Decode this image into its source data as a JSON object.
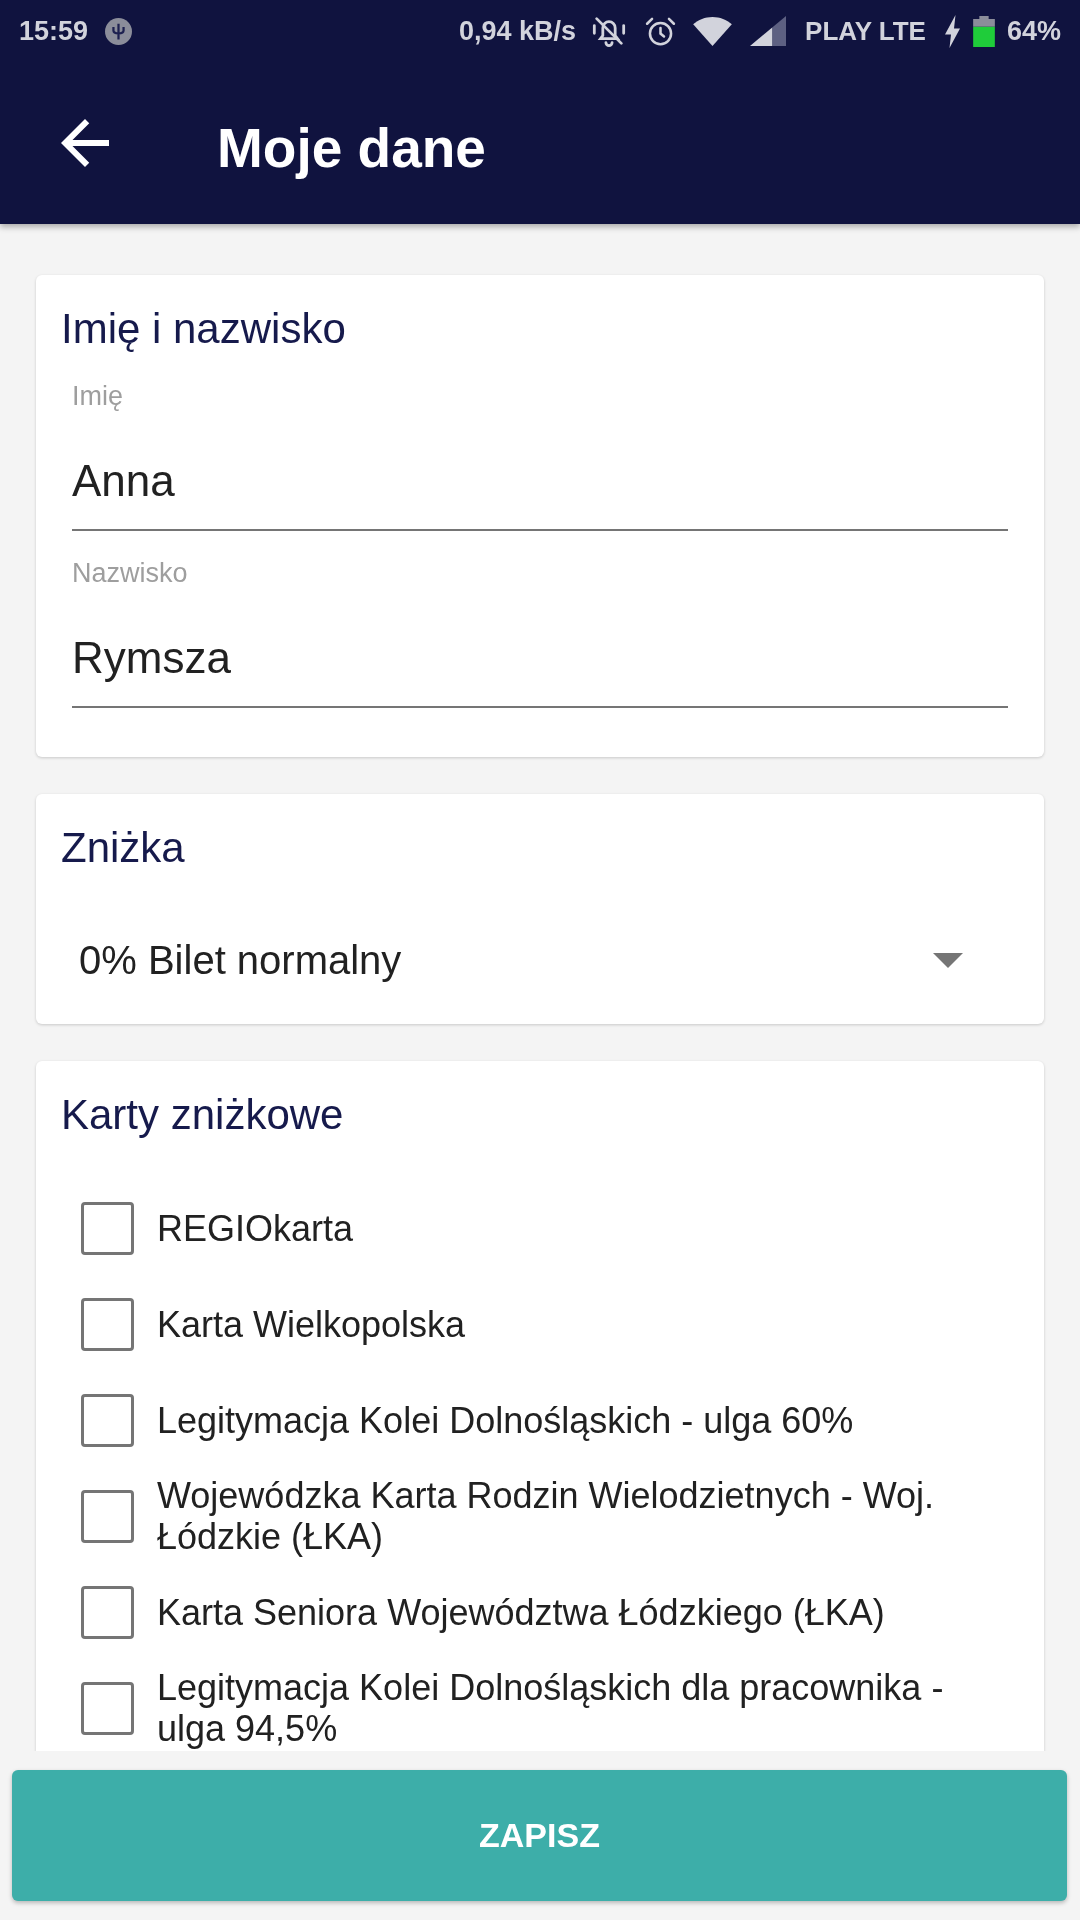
{
  "status_bar": {
    "time": "15:59",
    "network_speed": "0,94 kB/s",
    "carrier": "PLAY LTE",
    "battery": "64%"
  },
  "app_bar": {
    "title": "Moje dane"
  },
  "name_card": {
    "title": "Imię i nazwisko",
    "fields": [
      {
        "label": "Imię",
        "value": "Anna"
      },
      {
        "label": "Nazwisko",
        "value": "Rymsza"
      }
    ]
  },
  "discount_card": {
    "title": "Zniżka",
    "dropdown": {
      "value": "0% Bilet normalny"
    }
  },
  "discount_cards_card": {
    "title": "Karty zniżkowe",
    "options": [
      {
        "label": "REGIOkarta",
        "checked": false
      },
      {
        "label": "Karta Wielkopolska",
        "checked": false
      },
      {
        "label": "Legitymacja Kolei Dolnośląskich - ulga 60%",
        "checked": false
      },
      {
        "label": "Wojewódzka Karta Rodzin Wielodzietnych - Woj. Łódzkie (ŁKA)",
        "checked": false
      },
      {
        "label": "Karta Seniora Województwa Łódzkiego (ŁKA)",
        "checked": false
      },
      {
        "label": "Legitymacja Kolei Dolnośląskich dla pracownika - ulga 94,5%",
        "checked": false
      }
    ]
  },
  "save_button": {
    "label": "ZAPISZ"
  }
}
